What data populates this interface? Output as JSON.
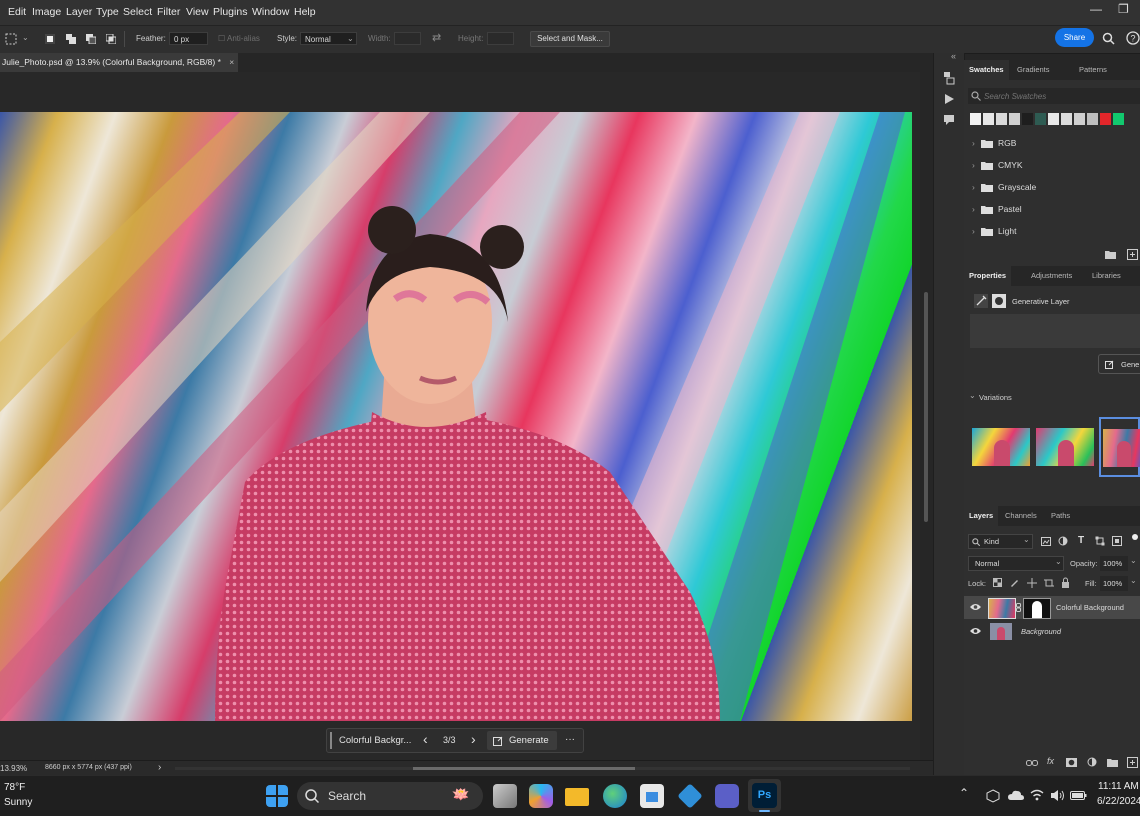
{
  "menu": [
    "Edit",
    "Image",
    "Layer",
    "Type",
    "Select",
    "Filter",
    "View",
    "Plugins",
    "Window",
    "Help"
  ],
  "options": {
    "feather_label": "Feather:",
    "feather_value": "0 px",
    "antialias_label": "Anti-alias",
    "style_label": "Style:",
    "style_value": "Normal",
    "width_label": "Width:",
    "height_label": "Height:",
    "select_mask": "Select and Mask...",
    "share": "Share"
  },
  "document": {
    "tab_title": "Julie_Photo.psd @ 13.9% (Colorful Background, RGB/8) *",
    "close": "×"
  },
  "contextual": {
    "layer_name": "Colorful Backgr...",
    "counter": "3/3",
    "prev": "‹",
    "next": "›",
    "generate": "Generate",
    "more": "···"
  },
  "status": {
    "zoom": "13.93%",
    "dimensions": "8660 px x 5774 px (437 ppi)",
    "arrow": "›"
  },
  "swatches": {
    "tabs": [
      "Swatches",
      "Gradients",
      "Patterns"
    ],
    "search_placeholder": "Search Swatches",
    "colors": [
      "#f2f2f2",
      "#e6e6e6",
      "#d9d9d9",
      "#cfcfcf",
      "#1e1e1e",
      "#2e5b52",
      "#e8e8e8",
      "#dcdcdc",
      "#d0d0d0",
      "#bfbfbf",
      "#e3262a",
      "#12c86e"
    ],
    "folders": [
      "RGB",
      "CMYK",
      "Grayscale",
      "Pastel",
      "Light"
    ]
  },
  "properties": {
    "tabs": [
      "Properties",
      "Adjustments",
      "Libraries"
    ],
    "layer_type": "Generative Layer",
    "generate_btn": "Gene",
    "variations_label": "Variations"
  },
  "layers": {
    "tabs": [
      "Layers",
      "Channels",
      "Paths"
    ],
    "kind": "Kind",
    "blend": "Normal",
    "opacity_label": "Opacity:",
    "opacity_value": "100%",
    "lock_label": "Lock:",
    "fill_label": "Fill:",
    "fill_value": "100%",
    "rows": [
      {
        "name": "Colorful Background"
      },
      {
        "name": "Background"
      }
    ]
  },
  "taskbar": {
    "temp": "78°F",
    "weather": "Sunny",
    "search": "Search",
    "time": "11:11 AM",
    "date": "6/22/2024",
    "ps": "Ps"
  },
  "icons": {
    "marquee": "marquee-icon",
    "search": "search-icon",
    "help": "help-icon",
    "folder": "folder-icon",
    "eye": "eye-icon"
  }
}
